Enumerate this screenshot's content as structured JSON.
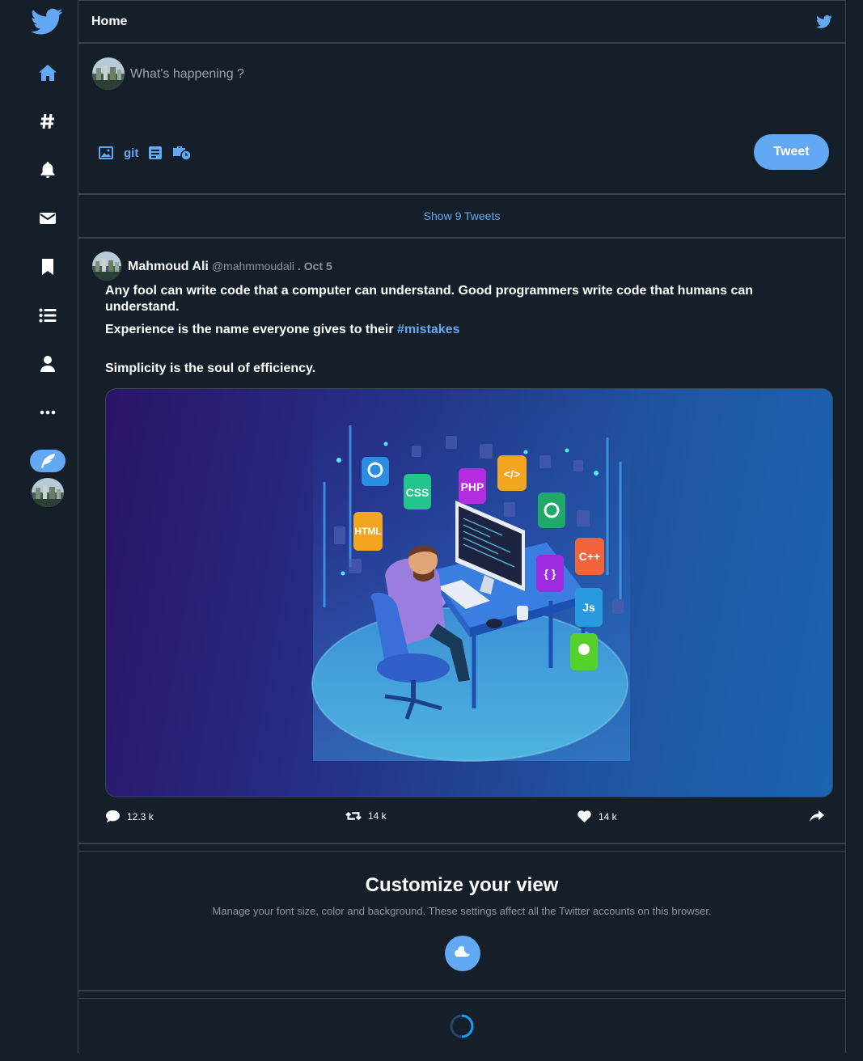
{
  "sidebar": {
    "items": [
      {
        "icon": "home-icon"
      },
      {
        "icon": "hashtag-icon"
      },
      {
        "icon": "bell-icon"
      },
      {
        "icon": "mail-icon"
      },
      {
        "icon": "bookmark-icon"
      },
      {
        "icon": "list-icon"
      },
      {
        "icon": "profile-icon"
      },
      {
        "icon": "more-icon"
      }
    ],
    "compose_icon": "feather-icon"
  },
  "header": {
    "title": "Home"
  },
  "composer": {
    "placeholder": "What's happening ?",
    "tools": {
      "image": "image-icon",
      "git": "git",
      "poll": "form-icon",
      "schedule": "briefcase-clock-icon"
    },
    "tweet_button": "Tweet"
  },
  "show_tweets": "Show 9 Tweets",
  "tweet": {
    "name": "Mahmoud Ali",
    "handle": "@mahmmoudali",
    "date": ". Oct 5",
    "line1": "Any fool can write code that a computer can understand. Good programmers write code that humans can understand.",
    "line2_prefix": "Experience is the name everyone gives to their ",
    "line2_hashtag": "#mistakes",
    "line3": "Simplicity is the soul of efficiency.",
    "image_badges": [
      "CSS",
      "PHP",
      "HTML",
      "C++",
      "Js"
    ],
    "actions": {
      "replies": "12.3 k",
      "retweets": "14 k",
      "likes": "14 k"
    }
  },
  "customize": {
    "title": "Customize your view",
    "description": "Manage your font size, color and background. These settings affect all the Twitter accounts on this browser."
  },
  "colors": {
    "background": "#151f2a",
    "accent": "#63a8f3",
    "border": "#3b4650",
    "muted_text": "#8b949c"
  }
}
